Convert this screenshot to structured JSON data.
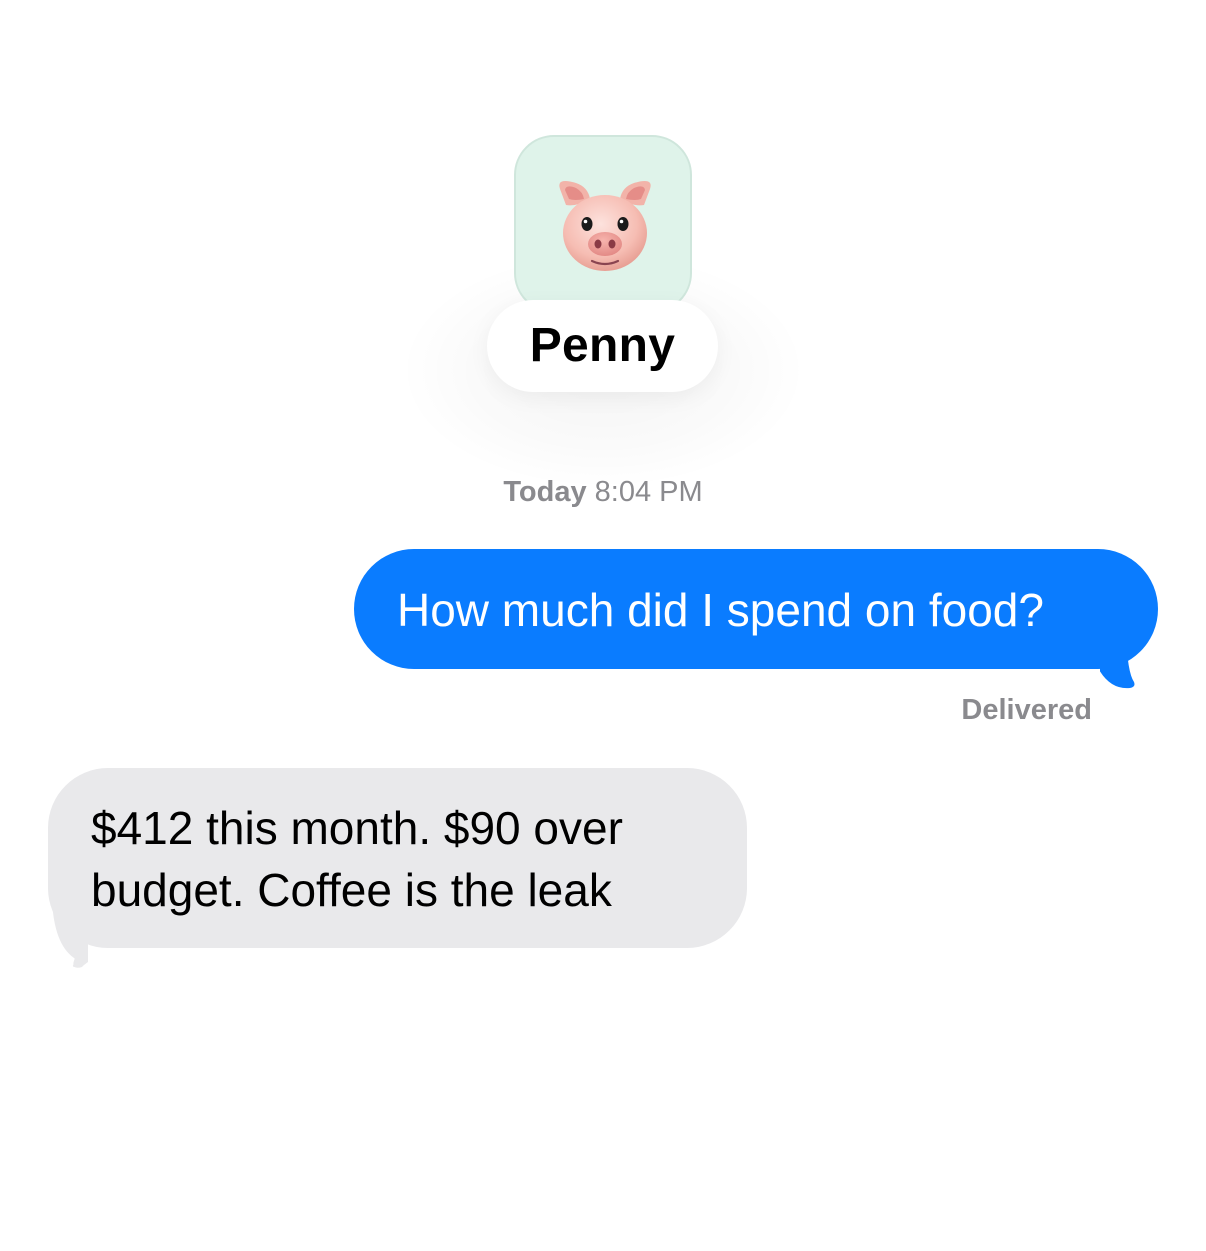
{
  "contact": {
    "name": "Penny",
    "avatar_icon": "pig-face-icon",
    "avatar_background": "#dff3ea"
  },
  "thread": {
    "timestamp_day": "Today",
    "timestamp_time": "8:04 PM",
    "messages": [
      {
        "direction": "sent",
        "text": "How much did I spend on food?",
        "bubble_color": "#0a7cff",
        "status": "Delivered"
      },
      {
        "direction": "received",
        "lines": [
          "$412 this month. $90 over",
          "budget. Coffee is the leak"
        ],
        "bubble_color": "#e9e9eb"
      }
    ]
  }
}
